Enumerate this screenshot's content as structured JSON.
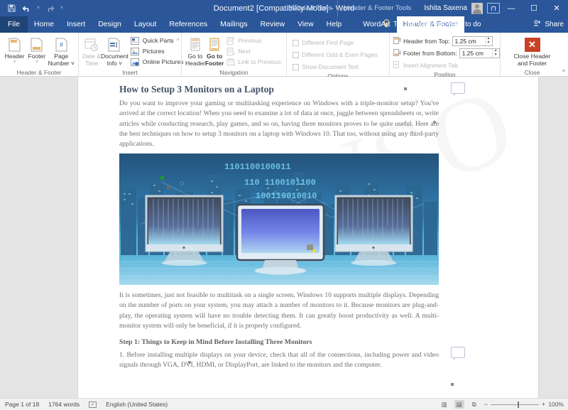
{
  "titlebar": {
    "document_title": "Document2 [Compatibility Mode]  -  Word",
    "qat": [
      {
        "name": "save-icon",
        "label": "Save"
      },
      {
        "name": "undo-icon",
        "label": "Undo"
      },
      {
        "name": "undo-dropdown-icon",
        "label": "˅"
      },
      {
        "name": "redo-icon",
        "label": "Redo"
      },
      {
        "name": "qat-customize-icon",
        "label": "˅"
      }
    ],
    "contextual_tabs": [
      "WordArt Tools",
      "Header & Footer Tools"
    ],
    "user_name": "Ishita Saxena",
    "window_controls": {
      "minimize": "—",
      "maximize": "☐",
      "close": "✕"
    }
  },
  "tabs": {
    "items": [
      {
        "label": "File",
        "active": false
      },
      {
        "label": "Home",
        "active": false
      },
      {
        "label": "Insert",
        "active": false
      },
      {
        "label": "Design",
        "active": false
      },
      {
        "label": "Layout",
        "active": false
      },
      {
        "label": "References",
        "active": false
      },
      {
        "label": "Mailings",
        "active": false
      },
      {
        "label": "Review",
        "active": false
      },
      {
        "label": "View",
        "active": false
      },
      {
        "label": "Help",
        "active": false
      },
      {
        "label": "WordArt",
        "active": false
      },
      {
        "label": "Header & Footer",
        "active": true
      }
    ],
    "tell_me_placeholder": "Tell me what you want to do",
    "share_label": "Share"
  },
  "ribbon": {
    "groups": [
      {
        "name": "header-footer",
        "label": "Header & Footer",
        "buttons": [
          {
            "label1": "Header",
            "label2": "˅",
            "icon": "header-icon",
            "disabled": false
          },
          {
            "label1": "Footer",
            "label2": "˅",
            "icon": "footer-icon",
            "disabled": false
          },
          {
            "label1": "Page",
            "label2": "Number ˅",
            "icon": "page-number-icon",
            "disabled": false
          }
        ]
      },
      {
        "name": "insert",
        "label": "Insert",
        "buttons": [
          {
            "label1": "Date &",
            "label2": "Time",
            "icon": "date-time-icon",
            "disabled": true
          },
          {
            "label1": "Document",
            "label2": "Info ˅",
            "icon": "document-info-icon",
            "disabled": false
          }
        ],
        "small_buttons": [
          {
            "label": "Quick Parts",
            "icon": "quick-parts-icon",
            "caret": true,
            "disabled": false
          },
          {
            "label": "Pictures",
            "icon": "pictures-icon",
            "caret": false,
            "disabled": false
          },
          {
            "label": "Online Pictures",
            "icon": "online-pictures-icon",
            "caret": false,
            "disabled": false
          }
        ]
      },
      {
        "name": "navigation",
        "label": "Navigation",
        "buttons": [
          {
            "label1": "Go to",
            "label2": "Header",
            "icon": "go-to-header-icon",
            "disabled": false
          },
          {
            "label1": "Go to",
            "label2": "Footer",
            "icon": "go-to-footer-icon",
            "disabled": false
          }
        ],
        "small_buttons": [
          {
            "label": "Previous",
            "icon": "previous-icon",
            "caret": false,
            "disabled": true
          },
          {
            "label": "Next",
            "icon": "next-icon",
            "caret": false,
            "disabled": true
          },
          {
            "label": "Link to Previous",
            "icon": "link-to-previous-icon",
            "caret": false,
            "disabled": true
          }
        ]
      },
      {
        "name": "options",
        "label": "Options",
        "checkboxes": [
          {
            "label": "Different First Page",
            "checked": false,
            "disabled": true
          },
          {
            "label": "Different Odd & Even Pages",
            "checked": false,
            "disabled": true
          },
          {
            "label": "Show Document Text",
            "checked": false,
            "disabled": true
          }
        ]
      },
      {
        "name": "position",
        "label": "Position",
        "rows": [
          {
            "label": "Header from Top:",
            "value": "1.25 cm",
            "icon": "header-position-icon",
            "disabled": false
          },
          {
            "label": "Footer from Bottom:",
            "value": "1.25 cm",
            "icon": "footer-position-icon",
            "disabled": false
          },
          {
            "label": "Insert Alignment Tab",
            "value": "",
            "icon": "alignment-tab-icon",
            "disabled": true
          }
        ]
      },
      {
        "name": "close",
        "label": "Close",
        "close_button": {
          "icon": "close-header-footer-icon",
          "label1": "Close Header",
          "label2": "and Footer",
          "glyph": "✕",
          "color": "#c94126"
        }
      }
    ],
    "collapse_icon": "collapse-ribbon-icon"
  },
  "document": {
    "heading": "How to Setup 3 Monitors on a Laptop",
    "paragraph1": "Do you want to improve your gaming or multitasking experience on Windows with a triple-monitor setup? You've arrived at the correct location! When you need to examine a lot of data at once, juggle between spreadsheets or, write articles while conducting research, play games, and so on, having three monitors proves to be quite useful. Here are the best techniques on how to setup 3 monitors on a laptop with Windows 10. That too, without using any third-party applications.",
    "image_alt": "three-monitors-image",
    "paragraph2": "It is sometimes, just not feasible to multitask on a single screen. Windows 10 supports multiple displays. Depending on the number of ports on your system, you may attach a number of monitors to it. Because monitors are plug-and-play, the operating system will have no trouble detecting them. It can greatly boost productivity as well. A multi-monitor system will only be beneficial, if it is properly configured.",
    "subheading": "Step 1: Things to Keep in Mind Before Installing Three Monitors",
    "paragraph3": "1. Before installing multiple displays on your device, check that all of the connections, including power and video signals through VGA, DVI, HDMI, or DisplayPort, are linked to the monitors and the computer.",
    "watermark_text": "WSOP"
  },
  "statusbar": {
    "page_info": "Page 1 of 18",
    "word_count": "1764 words",
    "proofing_icon": "proofing-errors-icon",
    "language": "English (United States)",
    "views": [
      {
        "name": "read-mode-view",
        "glyph": "▥",
        "active": false
      },
      {
        "name": "print-layout-view",
        "glyph": "▤",
        "active": true
      },
      {
        "name": "web-layout-view",
        "glyph": "⧉",
        "active": false
      }
    ],
    "zoom_out": "−",
    "zoom_in": "+",
    "zoom_level": "100%"
  }
}
